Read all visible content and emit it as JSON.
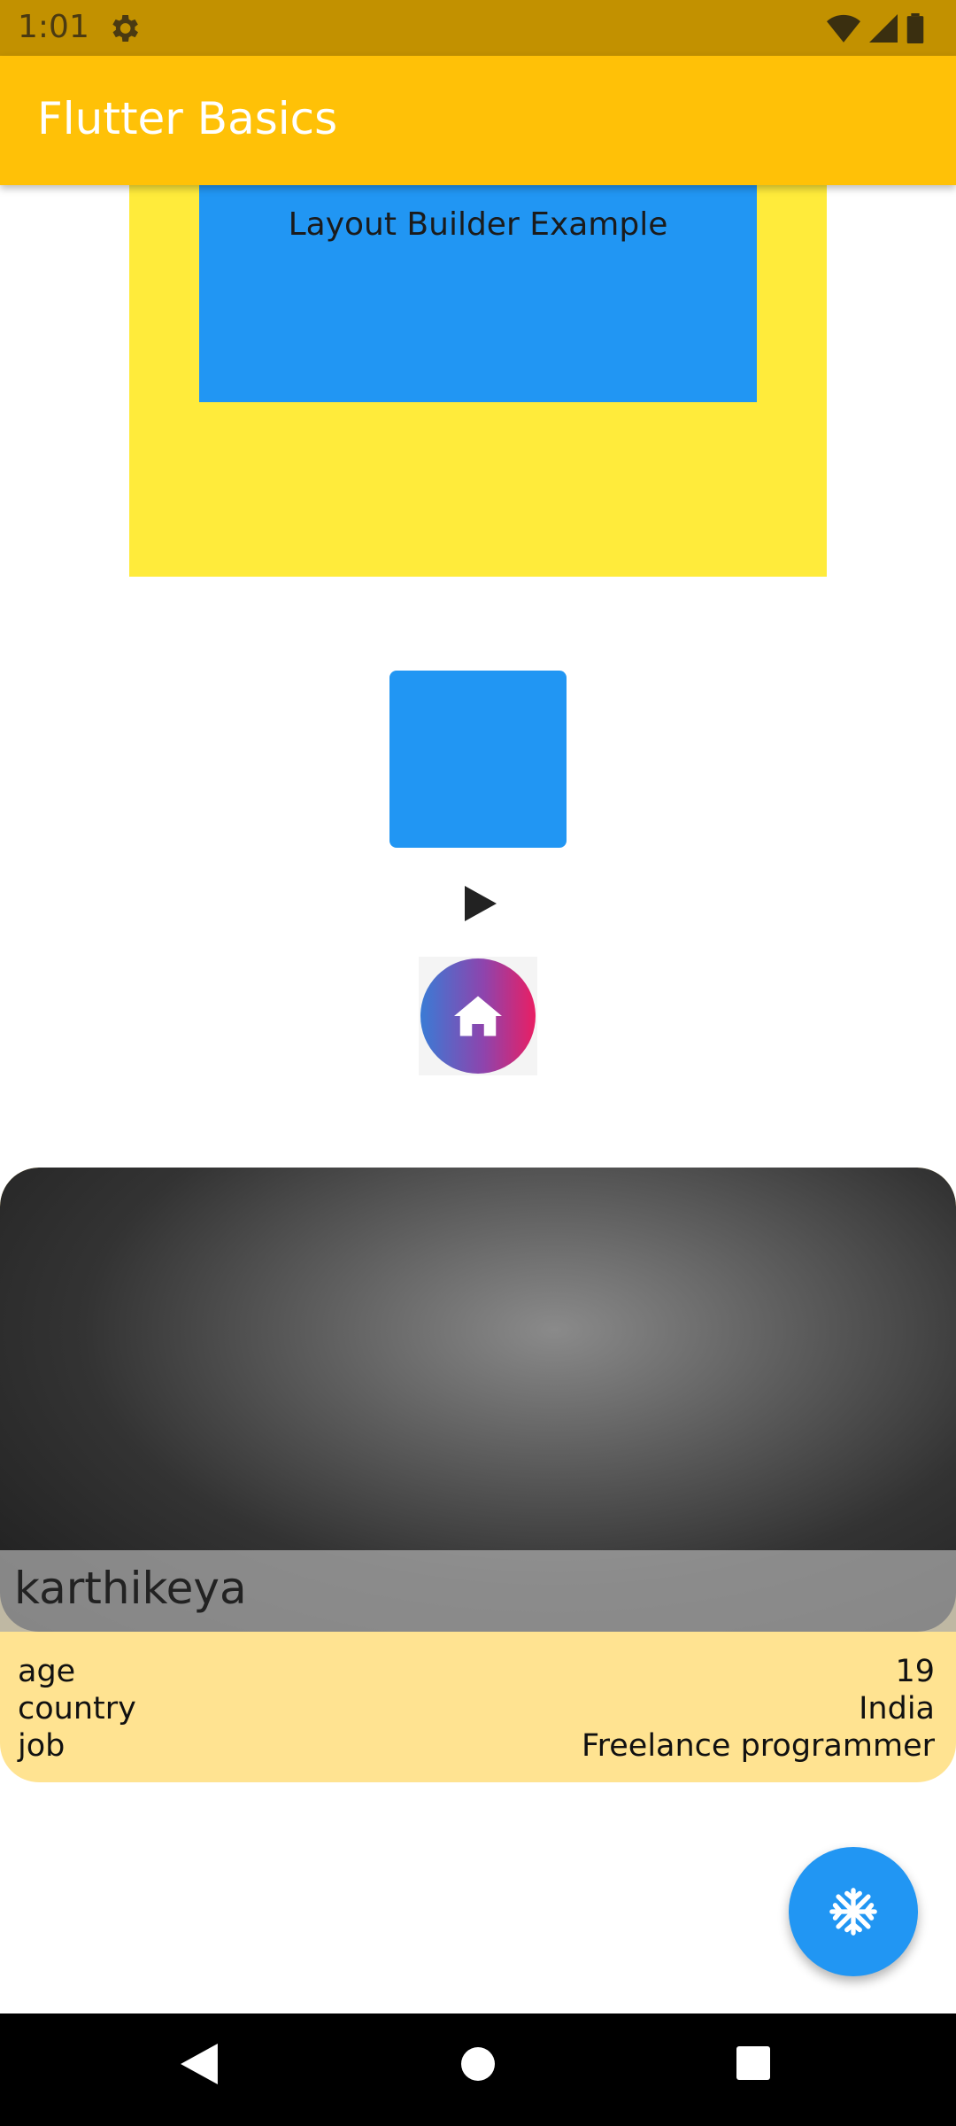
{
  "status_bar": {
    "time": "1:01",
    "icons": [
      "gear-icon",
      "wifi-icon",
      "signal-icon",
      "battery-icon"
    ]
  },
  "app_bar": {
    "title": "Flutter Basics",
    "color": "#FFC107"
  },
  "layout_builder": {
    "label": "Layout Builder Example",
    "outer_color": "#FFEB3B",
    "inner_color": "#2196F3"
  },
  "media": {
    "play_icon": "play-icon",
    "home_icon": "home-icon"
  },
  "profile": {
    "name": "karthikeya",
    "fields": [
      {
        "label": "age",
        "value": "19"
      },
      {
        "label": "country",
        "value": "India"
      },
      {
        "label": "job",
        "value": "Freelance programmer"
      }
    ],
    "card_color": "#FFE391"
  },
  "fab": {
    "icon": "snowflake-icon",
    "color": "#2196F3"
  },
  "nav_bar": {
    "buttons": [
      "back-icon",
      "home-nav-icon",
      "recents-icon"
    ]
  }
}
